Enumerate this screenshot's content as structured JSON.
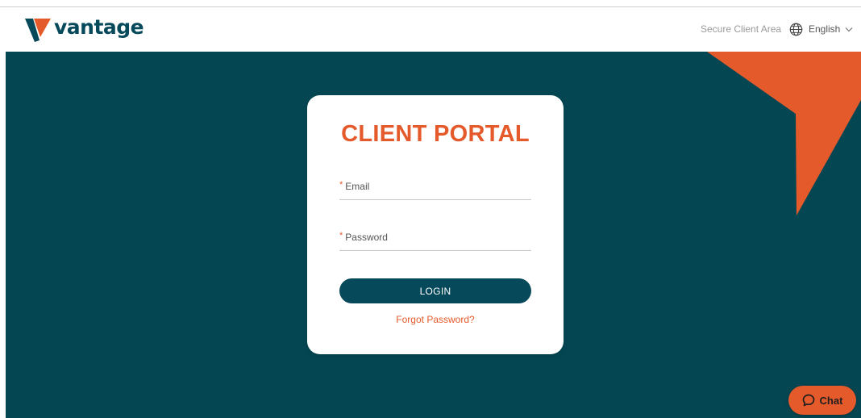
{
  "header": {
    "logo_text": "vantage",
    "secure_link": "Secure Client Area",
    "language": {
      "icon": "globe-icon",
      "label": "English",
      "chevron": "chevron-down-icon"
    }
  },
  "login_card": {
    "title": "CLIENT PORTAL",
    "email": {
      "required_mark": "*",
      "label": "Email",
      "value": ""
    },
    "password": {
      "required_mark": "*",
      "label": "Password",
      "value": ""
    },
    "login_button": "LOGIN",
    "forgot_link": "Forgot Password?"
  },
  "chat": {
    "icon": "chat-bubble-icon",
    "label": "Chat"
  },
  "colors": {
    "brand_teal": "#044753",
    "button_teal": "#05495a",
    "accent_orange": "#e55a2b",
    "logo_text": "#06495a"
  }
}
